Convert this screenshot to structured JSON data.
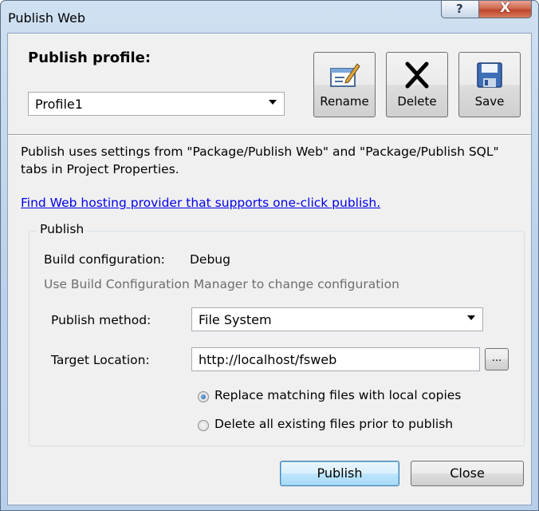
{
  "window": {
    "title": "Publish Web",
    "help_glyph": "?",
    "close_glyph": "X"
  },
  "profile": {
    "label": "Publish profile:",
    "selected": "Profile1",
    "buttons": {
      "rename": "Rename",
      "delete": "Delete",
      "save": "Save"
    }
  },
  "description": "Publish uses settings from \"Package/Publish Web\" and \"Package/Publish SQL\" tabs in Project Properties.",
  "hosting_link": "Find Web hosting provider that supports one-click publish.",
  "publish_group": {
    "title": "Publish",
    "build_config_label": "Build configuration:",
    "build_config_value": "Debug",
    "build_config_hint": "Use Build Configuration Manager to change configuration",
    "method_label": "Publish method:",
    "method_value": "File System",
    "target_label": "Target Location:",
    "target_value": "http://localhost/fsweb",
    "browse_label": "...",
    "options": [
      {
        "label": "Replace matching files with local copies",
        "checked": true
      },
      {
        "label": "Delete all existing files prior to publish",
        "checked": false
      }
    ]
  },
  "footer": {
    "publish": "Publish",
    "close": "Close"
  },
  "colors": {
    "title_bar": "#bcd3ea",
    "client_bg": "#f0f0f0",
    "link": "#0000ee",
    "close_button": "#c1452c",
    "default_button": "#bee6fd"
  },
  "icons": [
    "rename-icon",
    "delete-icon",
    "save-icon",
    "help-icon",
    "close-icon",
    "dropdown-arrow-icon"
  ]
}
